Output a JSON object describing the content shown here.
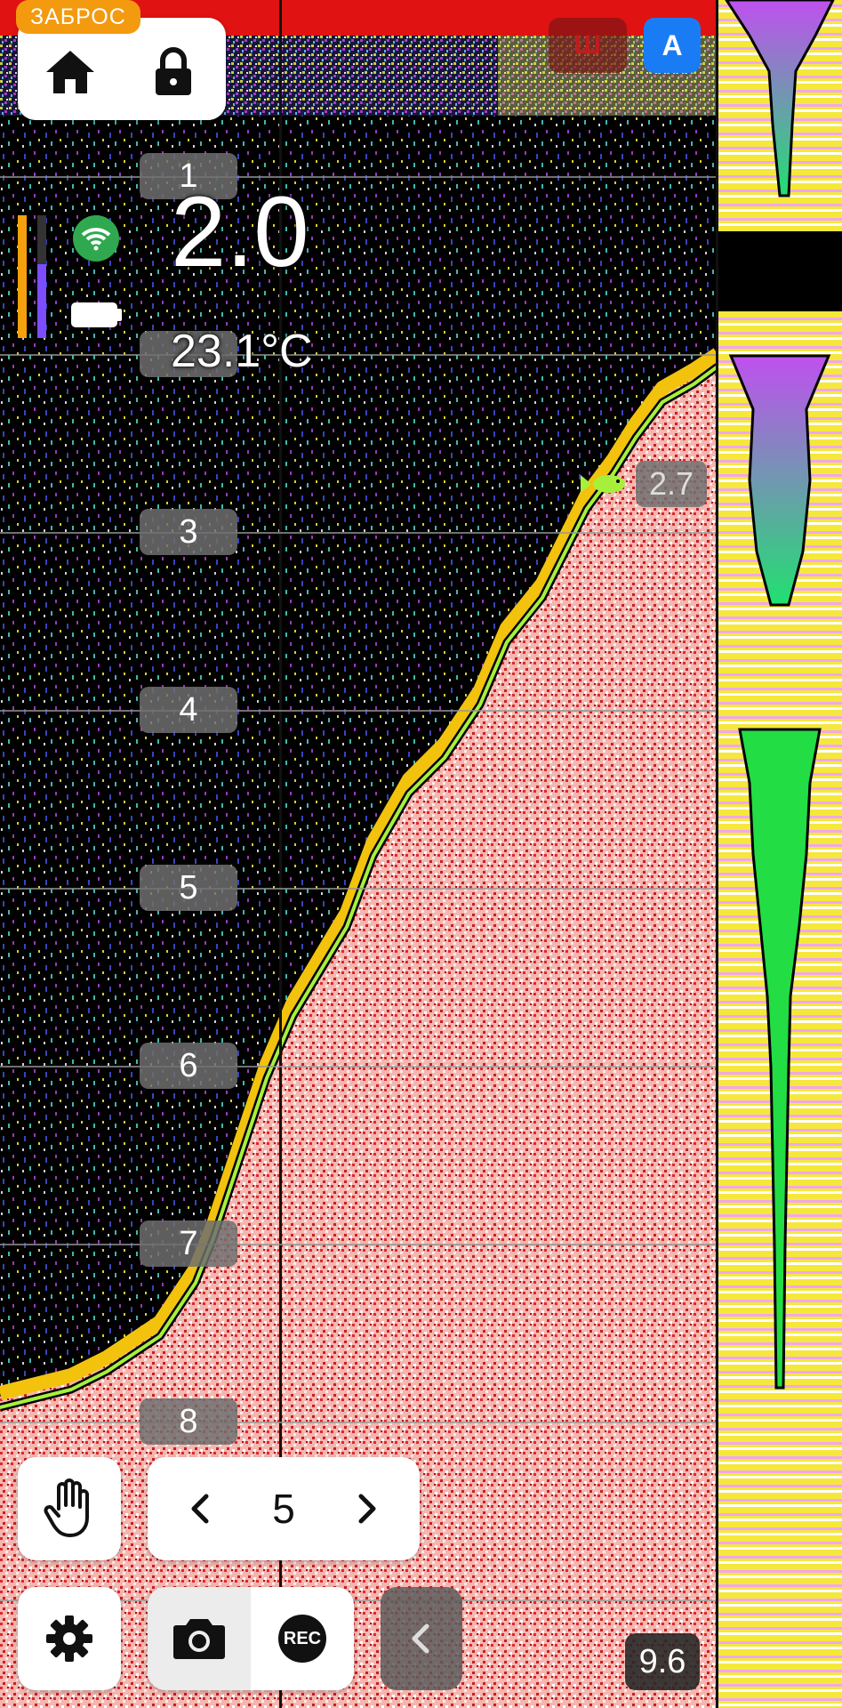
{
  "top_panel": {
    "cast_badge": "ЗАБРОС",
    "home_icon": "home-icon",
    "lock_icon": "lock-icon"
  },
  "status": {
    "wifi_icon": "wifi-icon",
    "battery_icon": "battery-icon",
    "sensitivity_level": 1.0,
    "signal_level": 0.6,
    "depth": "2.0",
    "temperature": "23.1°C"
  },
  "mode_buttons": {
    "mode_sh": "Ш",
    "mode_a": "A"
  },
  "depth_scale": [
    "1",
    "2",
    "3",
    "4",
    "5",
    "6",
    "7",
    "8"
  ],
  "fish": {
    "icon": "fish-icon",
    "depth": "2.7"
  },
  "zoom": {
    "hand_icon": "hand-icon",
    "prev_icon": "chevron-left-icon",
    "value": "5",
    "next_icon": "chevron-right-icon"
  },
  "bottom_bar": {
    "settings_icon": "gear-icon",
    "camera_icon": "camera-icon",
    "rec_label": "REC",
    "collapse_icon": "chevron-left-icon"
  },
  "range_value": "9.6",
  "colors": {
    "accent_orange": "#f39a0f",
    "mode_a_blue": "#1a7cf5",
    "mode_sh_red": "#c01c1c",
    "bottom_pink": "#f4b6b0",
    "bottom_line": "#a6f03c",
    "wifi_green": "#2fa84f"
  }
}
